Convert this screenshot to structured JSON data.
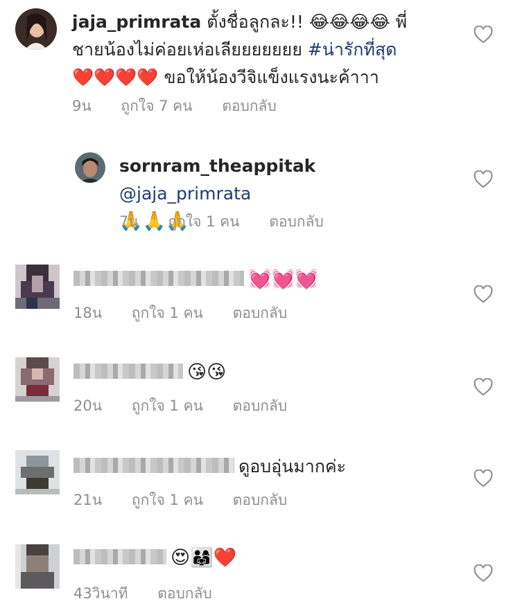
{
  "comments": [
    {
      "username": "jaja_primrata",
      "text_part1": "ตั้งชื่อลูกละ!! 😂😂😂😂 พี่",
      "text_part2": "ชายน้องไม่ค่อยเห่อเลียยยยยยย ",
      "hashtag": "#น่ารักที่สุด",
      "text_part3": "❤️❤️❤️❤️ ขอให้น้องวีจิแข็งแรงนะค้าาา",
      "time": "9น",
      "likes": "ถูกใจ 7 คน",
      "reply": "ตอบกลับ"
    },
    {
      "username": "sornram_theappitak",
      "mention": "@jaja_primrata",
      "text": "🙏🙏🙏",
      "time": "7น",
      "likes": "ถูกใจ 1 คน",
      "reply": "ตอบกลับ"
    },
    {
      "text": "💓💓💓",
      "time": "18น",
      "likes": "ถูกใจ 1 คน",
      "reply": "ตอบกลับ"
    },
    {
      "text": "😘😘",
      "time": "20น",
      "likes": "ถูกใจ 1 คน",
      "reply": "ตอบกลับ"
    },
    {
      "text": "ดูอบอุ่นมากค่ะ",
      "time": "21น",
      "likes": "ถูกใจ 1 คน",
      "reply": "ตอบกลับ"
    },
    {
      "text": "😍👨‍👩‍👧❤️",
      "time": "43วินาที",
      "reply": "ตอบกลับ"
    }
  ],
  "icons": {
    "like": "heart-outline-icon"
  },
  "colors": {
    "text": "#262626",
    "meta": "#8e8e8e",
    "link": "#1f3b73"
  }
}
